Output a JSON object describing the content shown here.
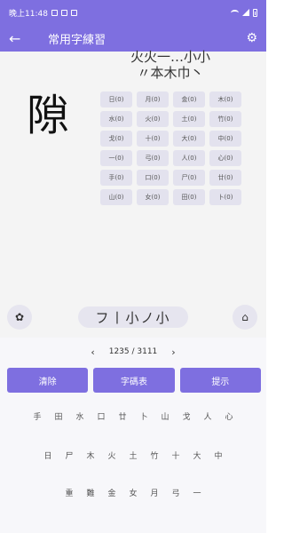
{
  "status": {
    "time": "晚上11:48"
  },
  "app": {
    "title": "常用字練習"
  },
  "character": "隙",
  "stroke_hint": [
    "火火一…小小",
    "〃本木巾丶"
  ],
  "grid": [
    "日(0)",
    "月(0)",
    "金(0)",
    "木(0)",
    "水(0)",
    "火(0)",
    "土(0)",
    "竹(0)",
    "戈(0)",
    "十(0)",
    "大(0)",
    "中(0)",
    "一(0)",
    "弓(0)",
    "人(0)",
    "心(0)",
    "手(0)",
    "口(0)",
    "尸(0)",
    "廿(0)",
    "山(0)",
    "女(0)",
    "田(0)",
    "卜(0)"
  ],
  "components": "フ丨小ノ小",
  "pager": {
    "text": "1235 / 3111"
  },
  "actions": [
    "清除",
    "字碼表",
    "提示"
  ],
  "keys": {
    "row1": [
      "手",
      "田",
      "水",
      "口",
      "廿",
      "卜",
      "山",
      "戈",
      "人",
      "心"
    ],
    "row2": [
      "日",
      "尸",
      "木",
      "火",
      "土",
      "竹",
      "十",
      "大",
      "中"
    ],
    "row3": [
      "重",
      "難",
      "金",
      "女",
      "月",
      "弓",
      "一"
    ]
  },
  "icons": {
    "back": "arrow-left",
    "settings": "gear",
    "left_round": "flower",
    "right_round": "home"
  },
  "colors": {
    "accent": "#7e6fe0",
    "cell": "#e3e2ee"
  }
}
